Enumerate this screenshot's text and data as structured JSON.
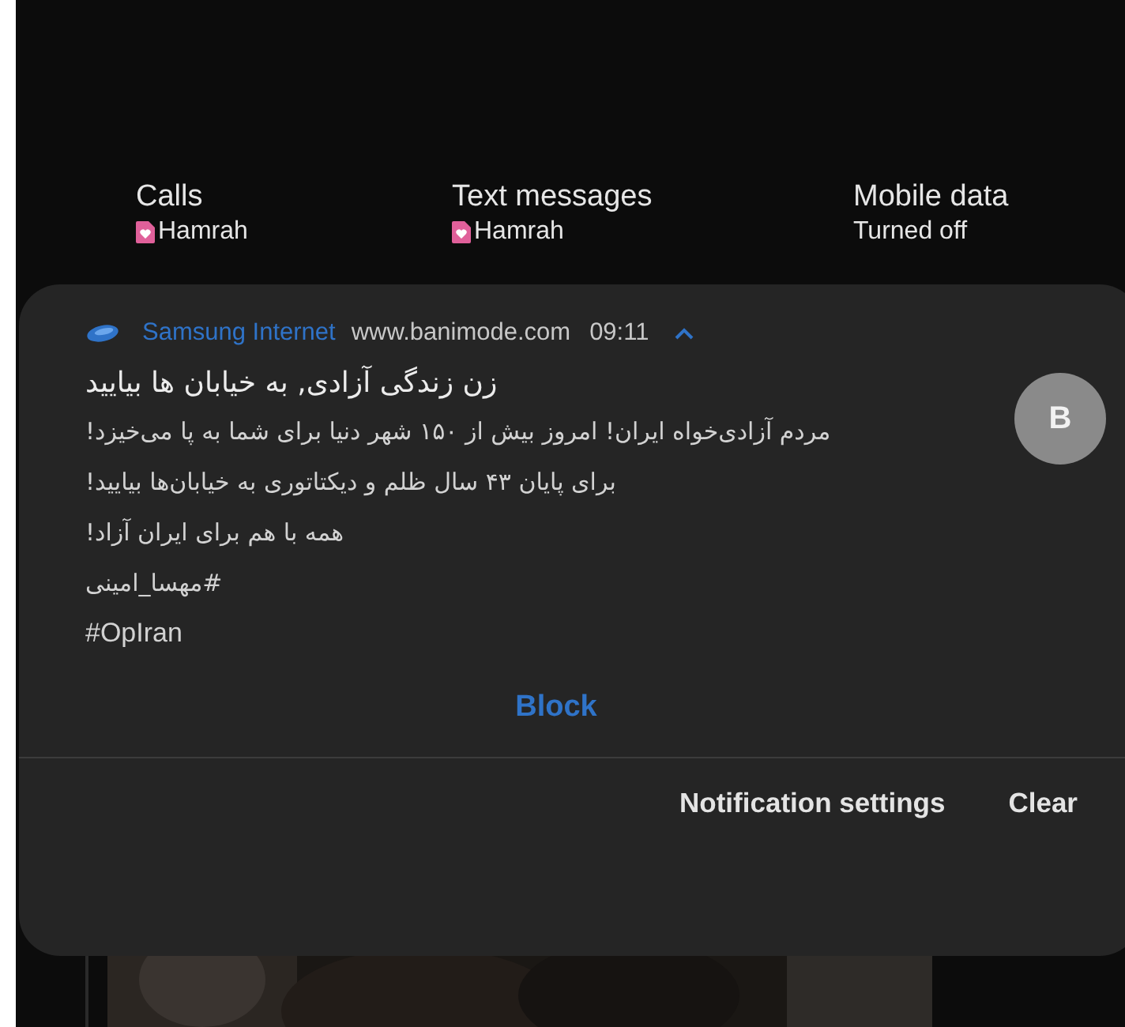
{
  "sim_info": [
    {
      "label": "Calls",
      "kind": "sim",
      "value": "Hamrah"
    },
    {
      "label": "Text messages",
      "kind": "sim",
      "value": "Hamrah"
    },
    {
      "label": "Mobile data",
      "kind": "text",
      "value": "Turned off"
    }
  ],
  "notification": {
    "app": "Samsung Internet",
    "site": "www.banimode.com",
    "time": "09:11",
    "expanded": true,
    "title": "زن زندگی آزادی, به خیابان ها بیایید",
    "body": [
      "مردم آزادی‌خواه ایران! امروز بیش از ۱۵۰ شهر دنیا برای شما به پا می‌خیزد!",
      "برای پایان ۴۳ سال ظلم و دیکتاتوری به خیابان‌ها بیایید!",
      "همه با هم برای ایران آزاد!",
      "#مهسا_امینی",
      "#OpIran"
    ],
    "avatar": "B",
    "action": "Block"
  },
  "footer_buttons": [
    "Notification settings",
    "Clear"
  ],
  "background": {
    "kind": "picture"
  }
}
